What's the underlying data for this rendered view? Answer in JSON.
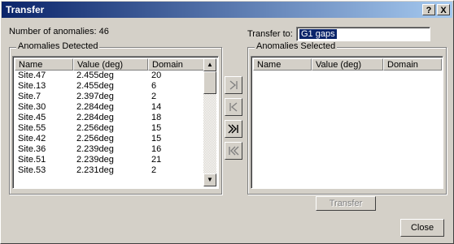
{
  "window": {
    "title": "Transfer",
    "help_label": "?",
    "close_label": "X"
  },
  "anomaly_count_text": "Number of anomalies: 46",
  "transfer_to": {
    "label": "Transfer to:",
    "value": "G1 gaps"
  },
  "detected": {
    "title": "Anomalies Detected",
    "columns": [
      "Name",
      "Value (deg)",
      "Domain"
    ],
    "rows": [
      [
        "Site.47",
        "2.455deg",
        "20"
      ],
      [
        "Site.13",
        "2.455deg",
        "6"
      ],
      [
        "Site.7",
        "2.397deg",
        "2"
      ],
      [
        "Site.30",
        "2.284deg",
        "14"
      ],
      [
        "Site.45",
        "2.284deg",
        "18"
      ],
      [
        "Site.55",
        "2.256deg",
        "15"
      ],
      [
        "Site.42",
        "2.256deg",
        "15"
      ],
      [
        "Site.36",
        "2.239deg",
        "16"
      ],
      [
        "Site.51",
        "2.239deg",
        "21"
      ],
      [
        "Site.53",
        "2.231deg",
        "2"
      ]
    ]
  },
  "selected": {
    "title": "Anomalies Selected",
    "columns": [
      "Name",
      "Value (deg)",
      "Domain"
    ],
    "rows": []
  },
  "buttons": {
    "transfer": "Transfer",
    "close": "Close"
  }
}
